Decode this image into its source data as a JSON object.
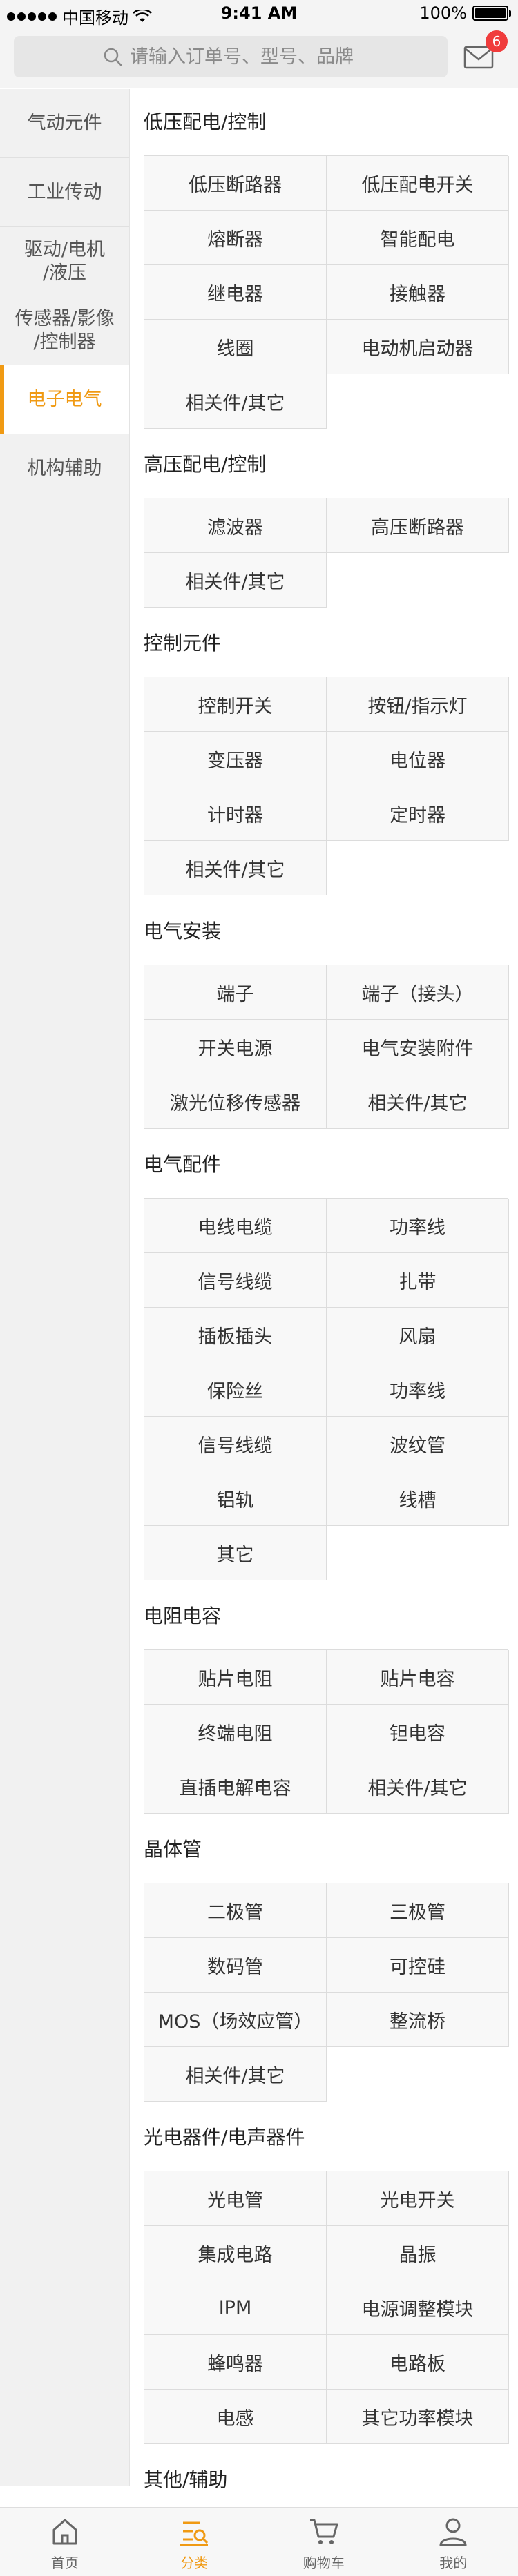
{
  "status_bar": {
    "carrier": "中国移动",
    "time": "9:41 AM",
    "battery": "100%",
    "battery_level": 1.0
  },
  "search": {
    "placeholder": "请输入订单号、型号、品牌"
  },
  "messages": {
    "badge_count": "6"
  },
  "sidebar": {
    "active_index": 4,
    "items": [
      {
        "label": "气动元件"
      },
      {
        "label": "工业传动"
      },
      {
        "label": "驱动/电机\n/液压"
      },
      {
        "label": "传感器/影像\n/控制器"
      },
      {
        "label": "电子电气"
      },
      {
        "label": "机构辅助"
      }
    ]
  },
  "sections": [
    {
      "title": "低压配电/控制",
      "items": [
        "低压断路器",
        "低压配电开关",
        "熔断器",
        "智能配电",
        "继电器",
        "接触器",
        "线圈",
        "电动机启动器",
        "相关件/其它"
      ]
    },
    {
      "title": "高压配电/控制",
      "items": [
        "滤波器",
        "高压断路器",
        "相关件/其它"
      ]
    },
    {
      "title": "控制元件",
      "items": [
        "控制开关",
        "按钮/指示灯",
        "变压器",
        "电位器",
        "计时器",
        "定时器",
        "相关件/其它"
      ]
    },
    {
      "title": "电气安装",
      "items": [
        "端子",
        "端子（接头）",
        "开关电源",
        "电气安装附件",
        "激光位移传感器",
        "相关件/其它"
      ]
    },
    {
      "title": "电气配件",
      "items": [
        "电线电缆",
        "功率线",
        "信号线缆",
        "扎带",
        "插板插头",
        "风扇",
        "保险丝",
        "功率线",
        "信号线缆",
        "波纹管",
        "铝轨",
        "线槽",
        "其它"
      ]
    },
    {
      "title": "电阻电容",
      "items": [
        "贴片电阻",
        "贴片电容",
        "终端电阻",
        "钽电容",
        "直插电解电容",
        "相关件/其它"
      ]
    },
    {
      "title": "晶体管",
      "items": [
        "二极管",
        "三极管",
        "数码管",
        "可控硅",
        "MOS（场效应管）",
        "整流桥",
        "相关件/其它"
      ]
    },
    {
      "title": "光电器件/电声器件",
      "items": [
        "光电管",
        "光电开关",
        "集成电路",
        "晶振",
        "IPM",
        "电源调整模块",
        "蜂鸣器",
        "电路板",
        "电感",
        "其它功率模块"
      ]
    },
    {
      "title": "其他/辅助",
      "items": []
    }
  ],
  "tabbar": {
    "active_index": 1,
    "tabs": [
      {
        "label": "首页",
        "icon": "home-icon"
      },
      {
        "label": "分类",
        "icon": "category-icon"
      },
      {
        "label": "购物车",
        "icon": "cart-icon"
      },
      {
        "label": "我的",
        "icon": "profile-icon"
      }
    ]
  },
  "colors": {
    "accent": "#f09a13",
    "badge": "#f03c3c",
    "sidebar_bg": "#f1f1f1",
    "cell_bg": "#f8f8f8"
  }
}
